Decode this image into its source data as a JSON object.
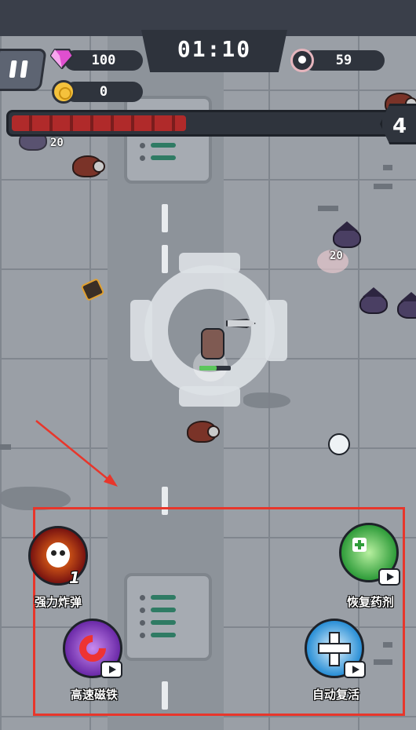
{
  "hud": {
    "gems": "100",
    "coins": "0",
    "timer": "01:10",
    "kills": "59",
    "level": "4",
    "xp_fraction": 0.46
  },
  "world": {
    "damage_numbers": [
      "20",
      "20"
    ]
  },
  "items": [
    {
      "name": "bomb",
      "label": "强力炸弹",
      "count": "1",
      "icon": "skull-bomb-icon"
    },
    {
      "name": "potion",
      "label": "恢复药剂",
      "icon": "heal-potion-icon",
      "ad": true
    },
    {
      "name": "magnet",
      "label": "高速磁铁",
      "icon": "magnet-icon",
      "ad": true
    },
    {
      "name": "revive",
      "label": "自动复活",
      "icon": "revive-cross-icon",
      "ad": true
    }
  ],
  "colors": {
    "highlight_box": "#e8362b",
    "xp": "#b02a2a",
    "road": "#8d939a"
  }
}
